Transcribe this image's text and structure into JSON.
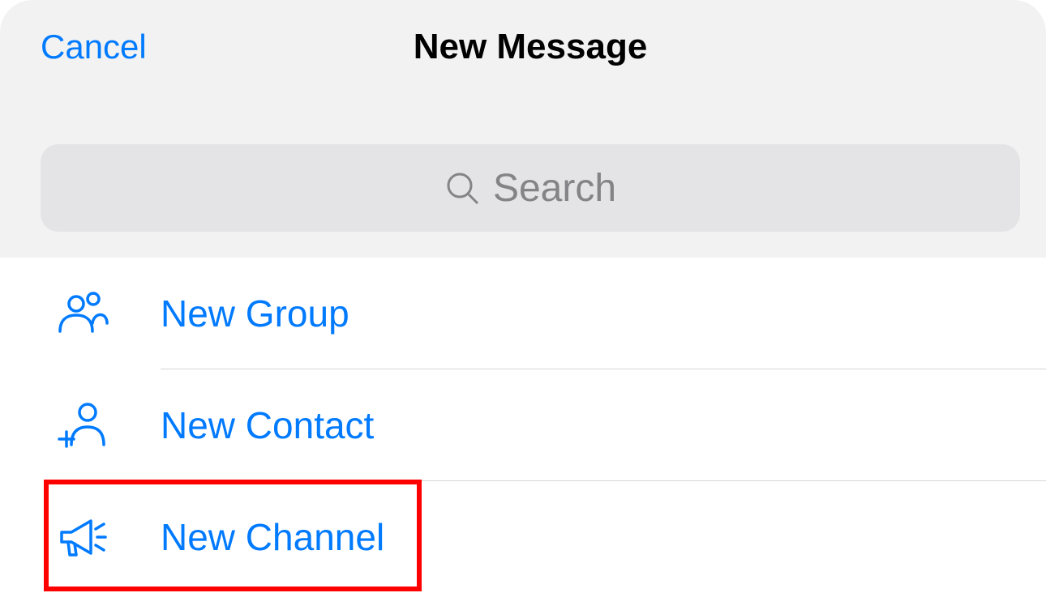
{
  "header": {
    "cancel_label": "Cancel",
    "title": "New Message"
  },
  "search": {
    "placeholder": "Search"
  },
  "options": [
    {
      "label": "New Group"
    },
    {
      "label": "New Contact"
    },
    {
      "label": "New Channel"
    }
  ]
}
